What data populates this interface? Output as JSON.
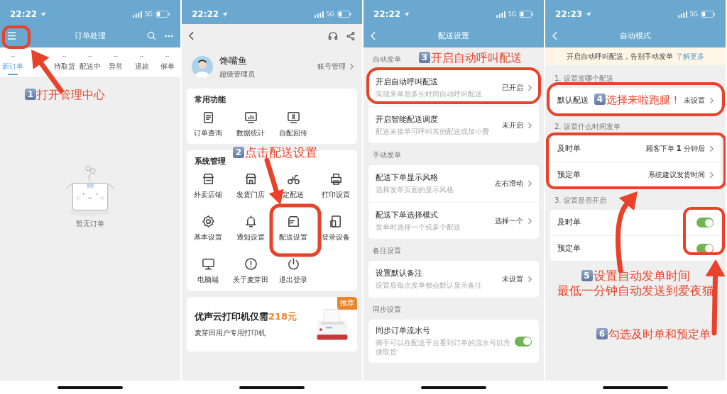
{
  "screens": [
    {
      "kind": "orders",
      "status_bar": {
        "time": "22:22",
        "network": "5G"
      },
      "title": "订单处理",
      "tabs": [
        {
          "count": "--",
          "label": "新订单",
          "selected": true
        },
        {
          "selected": false
        },
        {
          "count": "--",
          "label": "待取货",
          "selected": false
        },
        {
          "count": "--",
          "label": "配送中",
          "selected": false
        },
        {
          "count": "--",
          "label": "异常",
          "selected": false
        },
        {
          "count": "--",
          "label": "退款",
          "selected": false
        },
        {
          "count": "--",
          "label": "催单",
          "selected": false
        }
      ],
      "empty_text": "暂无订单",
      "callouts": [
        {
          "step": "1",
          "lines": [
            "打开管理中心"
          ]
        }
      ]
    },
    {
      "kind": "manage",
      "status_bar": {
        "time": "22:22",
        "network": "5G"
      },
      "profile": {
        "name": "馋嘴鱼",
        "role": "超级管理员",
        "link": "账号管理"
      },
      "sections": [
        {
          "title": "常用功能",
          "items": [
            "订单查询",
            "数据统计",
            "自配回传"
          ]
        },
        {
          "title": "系统管理",
          "items": [
            "外卖店铺",
            "发货门店",
            "定配送",
            "打印设置",
            "基本设置",
            "通知设置",
            "配送设置",
            "登录设备",
            "电脑端",
            "关于麦芽田",
            "退出登录"
          ]
        }
      ],
      "promo": {
        "badge": "推荐",
        "title": "优声云打印机仅需",
        "price": "218元",
        "subtitle": "麦芽田用户专用打印机"
      },
      "callouts": [
        {
          "step": "2",
          "lines": [
            "点击配送设置"
          ]
        }
      ]
    },
    {
      "kind": "delivery",
      "status_bar": {
        "time": "22:22",
        "network": "5G"
      },
      "title": "配送设置",
      "groups": [
        {
          "title": "自动发单",
          "rows": [
            {
              "kind": "link",
              "title": "开启自动呼叫配送",
              "subtitle": "实现来单后多长时间自动呼叫配送",
              "value": "已开启"
            },
            {
              "kind": "link",
              "title": "开启智能配送调度",
              "subtitle": "配送未接单可呼叫其他配送或加小费",
              "value": "未开启"
            }
          ]
        },
        {
          "title": "手动发单",
          "rows": [
            {
              "kind": "link",
              "title": "配送下单显示风格",
              "subtitle": "选择发单页面的显示风格",
              "value": "左右滑动"
            },
            {
              "kind": "link",
              "title": "配送下单选择模式",
              "subtitle": "发单时选择一个或多个配送",
              "value": "选择一个"
            }
          ]
        },
        {
          "title": "备注设置",
          "rows": [
            {
              "kind": "link",
              "title": "设置默认备注",
              "subtitle": "设置后每次发单都会默认显示备注",
              "value": "未设置"
            }
          ]
        },
        {
          "title": "同步设置",
          "rows": [
            {
              "kind": "toggle",
              "title": "同步订单流水号",
              "subtitle": "骑手可以在配送平台看到订单的流水号以方便取货",
              "on": true
            }
          ]
        }
      ],
      "callouts": [
        {
          "step": "3",
          "lines": [
            "开启自动呼叫配送"
          ]
        }
      ]
    },
    {
      "kind": "auto",
      "status_bar": {
        "time": "22:23",
        "network": "5G"
      },
      "title": "自动模式",
      "notice": {
        "text": "开启自动呼叫配送，告别手动发单",
        "link": "了解更多"
      },
      "groups": [
        {
          "title": "1. 设置发哪个配送",
          "rows": [
            {
              "kind": "link",
              "title": "默认配送",
              "value": "未设置"
            }
          ]
        },
        {
          "title": "2. 设置什么时间发单",
          "rows": [
            {
              "kind": "link",
              "title": "及时单",
              "value": "顾客下单 **1** 分钟后"
            },
            {
              "kind": "link",
              "title": "预定单",
              "value": "系统建议发货时间"
            }
          ]
        },
        {
          "title": "3. 设置是否开启",
          "rows": [
            {
              "kind": "toggle",
              "title": "及时单",
              "on": true
            },
            {
              "kind": "toggle",
              "title": "预定单",
              "on": true
            }
          ]
        }
      ],
      "callouts": [
        {
          "step": "4",
          "lines": [
            "选择来啦跑腿！"
          ]
        },
        {
          "step": "5",
          "lines": [
            "设置自动发单时间",
            "最低一分钟自动发送到爱夜猫"
          ]
        },
        {
          "step": "6",
          "lines": [
            "勾选及时单和预定单"
          ]
        }
      ]
    }
  ]
}
